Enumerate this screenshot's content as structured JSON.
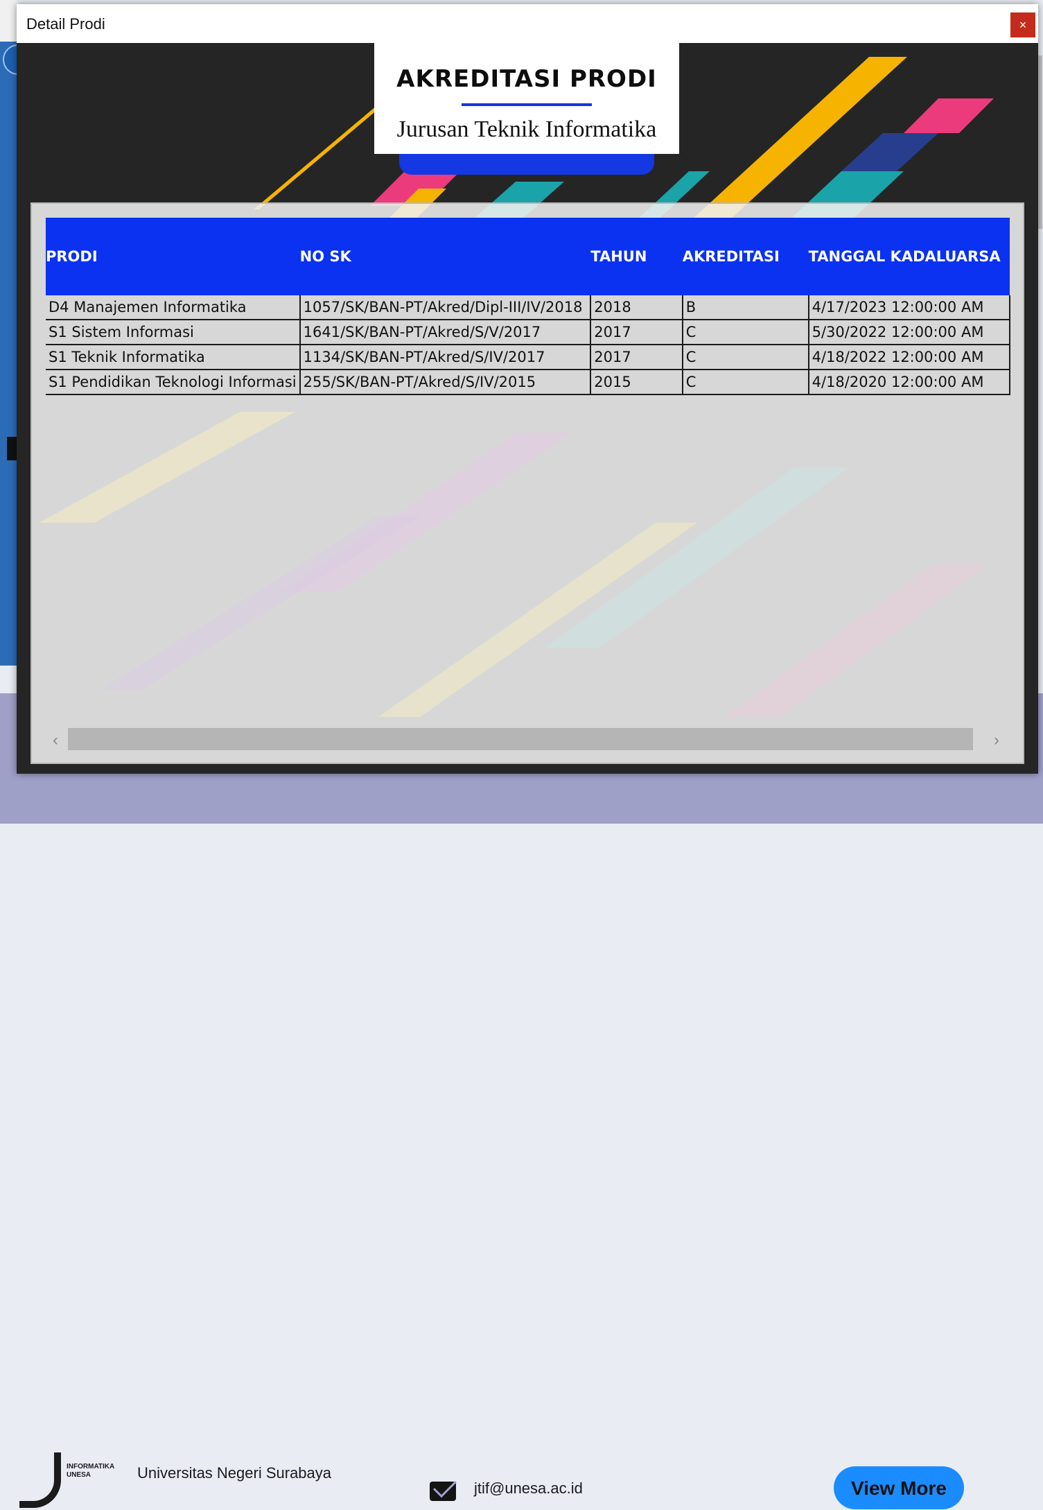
{
  "window": {
    "title": "Detail Prodi",
    "close_label": "×"
  },
  "header": {
    "title": "AKREDITASI PRODI",
    "subtitle": "Jurusan Teknik Informatika"
  },
  "table": {
    "columns": [
      "PRODI",
      "NO SK",
      "TAHUN",
      "AKREDITASI",
      "TANGGAL KADALUARSA"
    ],
    "rows": [
      [
        "D4 Manajemen Informatika",
        "1057/SK/BAN-PT/Akred/Dipl-III/IV/2018",
        "2018",
        "B",
        "4/17/2023 12:00:00 AM"
      ],
      [
        "S1 Sistem Informasi",
        "1641/SK/BAN-PT/Akred/S/V/2017",
        "2017",
        "C",
        "5/30/2022 12:00:00 AM"
      ],
      [
        "S1 Teknik Informatika",
        "1134/SK/BAN-PT/Akred/S/IV/2017",
        "2017",
        "C",
        "4/18/2022 12:00:00 AM"
      ],
      [
        "S1 Pendidikan Teknologi Informasi",
        "255/SK/BAN-PT/Akred/S/IV/2015",
        "2015",
        "C",
        "4/18/2020 12:00:00 AM"
      ]
    ]
  },
  "scrollbar": {
    "left_arrow": "‹",
    "right_arrow": "›"
  },
  "background_footer": {
    "logo_text_1": "INFORMATIKA",
    "logo_text_2": "UNESA",
    "university": "Universitas Negeri Surabaya",
    "email": "jtif@unesa.ac.id",
    "view_more": "View More"
  },
  "colors": {
    "header_blue": "#0a32f0",
    "close_red": "#c42b1c",
    "view_more_blue": "#1a8cff",
    "dark_bg": "#252525"
  }
}
